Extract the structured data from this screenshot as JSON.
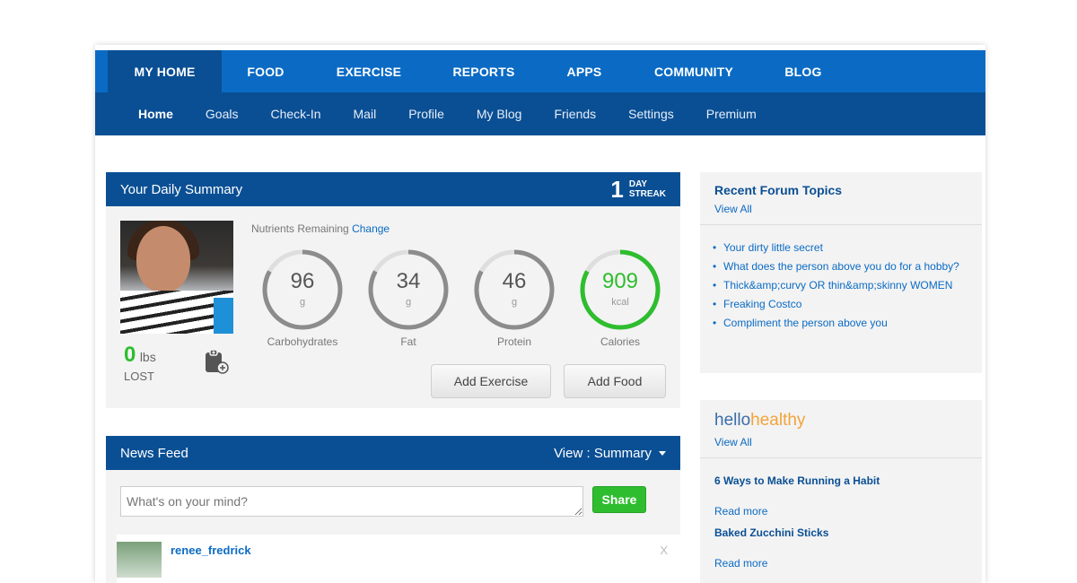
{
  "nav": {
    "tabs": [
      {
        "label": "MY HOME"
      },
      {
        "label": "FOOD"
      },
      {
        "label": "EXERCISE"
      },
      {
        "label": "REPORTS"
      },
      {
        "label": "APPS"
      },
      {
        "label": "COMMUNITY"
      },
      {
        "label": "BLOG"
      }
    ],
    "active_tab": "MY HOME",
    "subitems": [
      {
        "label": "Home"
      },
      {
        "label": "Goals"
      },
      {
        "label": "Check-In"
      },
      {
        "label": "Mail"
      },
      {
        "label": "Profile"
      },
      {
        "label": "My Blog"
      },
      {
        "label": "Friends"
      },
      {
        "label": "Settings"
      },
      {
        "label": "Premium"
      }
    ],
    "active_subitem": "Home"
  },
  "summary": {
    "title": "Your Daily Summary",
    "streak_number": "1",
    "streak_line1": "DAY",
    "streak_line2": "STREAK",
    "weight_lost": "0",
    "weight_unit": "lbs",
    "weight_label": "LOST",
    "nutrients_label": "Nutrients Remaining",
    "change_link": "Change",
    "nutrients": [
      {
        "value": "96",
        "unit": "g",
        "label": "Carbohydrates",
        "progress": 0.83,
        "color": "#8c8c8c"
      },
      {
        "value": "34",
        "unit": "g",
        "label": "Fat",
        "progress": 0.83,
        "color": "#8c8c8c"
      },
      {
        "value": "46",
        "unit": "g",
        "label": "Protein",
        "progress": 0.83,
        "color": "#8c8c8c"
      },
      {
        "value": "909",
        "unit": "kcal",
        "label": "Calories",
        "progress": 0.83,
        "color": "#2ebd2e"
      }
    ],
    "add_exercise": "Add Exercise",
    "add_food": "Add Food"
  },
  "newsfeed": {
    "title": "News Feed",
    "view_label": "View : Summary",
    "placeholder": "What's on your mind?",
    "share_label": "Share",
    "post_user": "renee_fredrick",
    "close": "X"
  },
  "forum": {
    "title": "Recent Forum Topics",
    "view_all": "View All",
    "topics": [
      "Your dirty little secret",
      "What does the person above you do for a hobby?",
      "Thick&amp;curvy OR thin&amp;skinny WOMEN",
      "Freaking Costco",
      "Compliment the person above you"
    ]
  },
  "hello": {
    "logo_a": "hello",
    "logo_b": "healthy",
    "view_all": "View All",
    "articles": [
      {
        "title": "6 Ways to Make Running a Habit",
        "read_more": "Read more"
      },
      {
        "title": "Baked Zucchini Sticks",
        "read_more": "Read more"
      }
    ]
  },
  "colors": {
    "nav_blue": "#0b6bc4",
    "dark_blue": "#0a4f94",
    "green": "#2ebd2e"
  }
}
